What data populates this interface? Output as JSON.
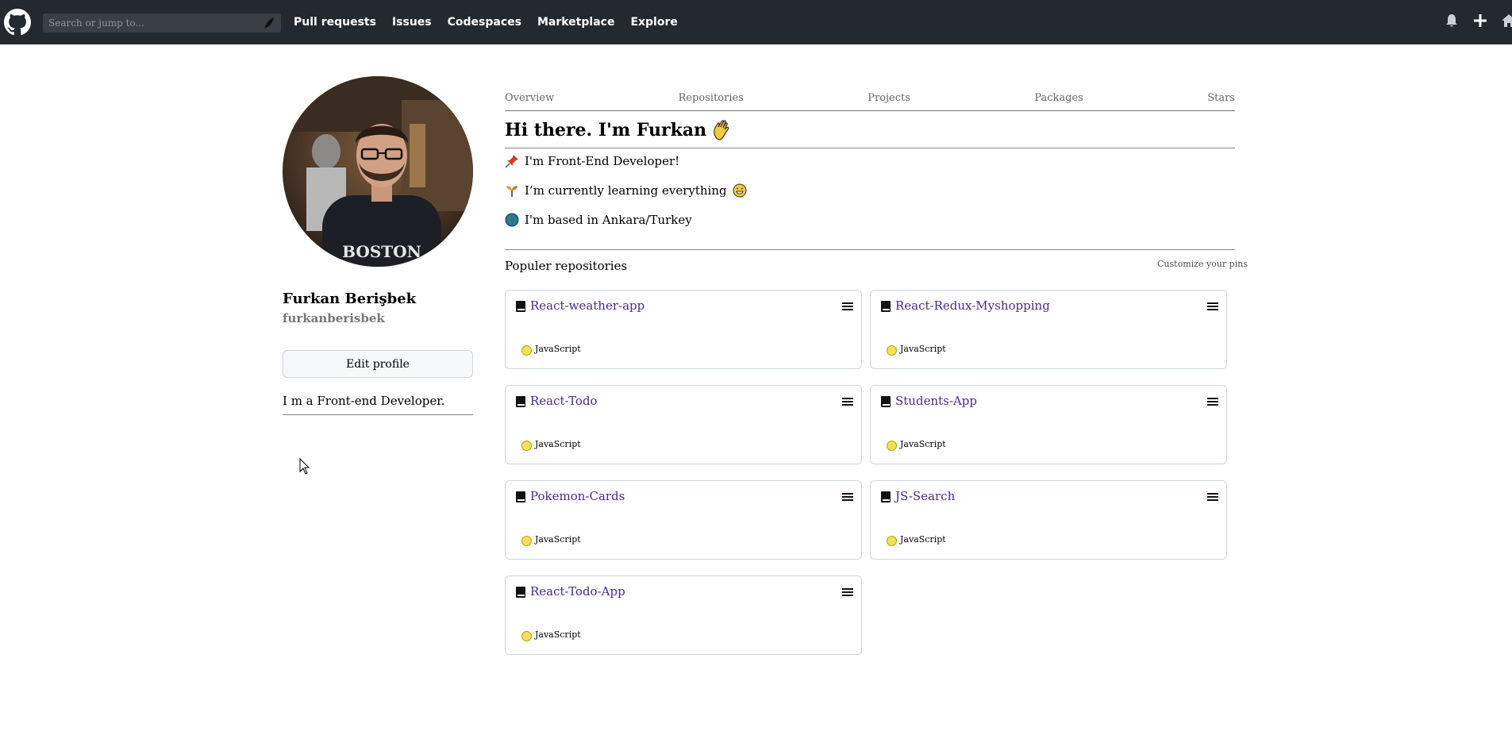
{
  "topbar": {
    "search_placeholder": "Search or jump to...",
    "nav": [
      "Pull requests",
      "Issues",
      "Codespaces",
      "Marketplace",
      "Explore"
    ]
  },
  "profile": {
    "name": "Furkan Berişbek",
    "username": "furkanberisbek",
    "edit_label": "Edit profile",
    "bio": "I m a Front-end Developer."
  },
  "tabs": [
    "Overview",
    "Repositories",
    "Projects",
    "Packages",
    "Stars"
  ],
  "readme": {
    "greeting": "Hi there. I'm Furkan",
    "lines": [
      {
        "icon": "pushpin-icon",
        "text": "I'm Front-End Developer!"
      },
      {
        "icon": "seedling-icon",
        "text": "I’m currently learning everything"
      },
      {
        "icon": "globe-icon",
        "text": "I'm based in Ankara/Turkey"
      }
    ]
  },
  "pinned": {
    "title": "Populer repositories",
    "customize": "Customize your pins",
    "repos": [
      {
        "name": "React-weather-app",
        "language": "JavaScript"
      },
      {
        "name": "React-Redux-Myshopping",
        "language": "JavaScript"
      },
      {
        "name": "React-Todo",
        "language": "JavaScript"
      },
      {
        "name": "Students-App",
        "language": "JavaScript"
      },
      {
        "name": "Pokemon-Cards",
        "language": "JavaScript"
      },
      {
        "name": "JS-Search",
        "language": "JavaScript"
      },
      {
        "name": "React-Todo-App",
        "language": "JavaScript"
      }
    ]
  },
  "colors": {
    "topbar": "#24292f",
    "link": "#4a2b8c",
    "javascript": "#f1e05a"
  }
}
